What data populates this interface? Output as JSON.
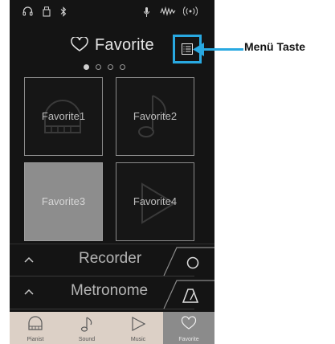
{
  "header": {
    "title": "Favorite"
  },
  "favorites": [
    {
      "label": "Favorite1",
      "selected": false
    },
    {
      "label": "Favorite2",
      "selected": false
    },
    {
      "label": "Favorite3",
      "selected": true
    },
    {
      "label": "Favorite4",
      "selected": false
    }
  ],
  "sections": [
    {
      "label": "Recorder",
      "icon": "circle-record-icon"
    },
    {
      "label": "Metronome",
      "icon": "metronome-icon"
    }
  ],
  "tabs": [
    {
      "label": "Pianist",
      "icon": "piano-icon",
      "active": false
    },
    {
      "label": "Sound",
      "icon": "music-note-icon",
      "active": false
    },
    {
      "label": "Music",
      "icon": "play-icon",
      "active": false
    },
    {
      "label": "Favorite",
      "icon": "heart-icon",
      "active": true
    }
  ],
  "callout": {
    "text": "Menü Taste"
  },
  "colors": {
    "accent": "#29a9e1",
    "background": "#141414",
    "tab_bar": "#dcd0c6",
    "selected_tile": "#8d8d8d"
  }
}
